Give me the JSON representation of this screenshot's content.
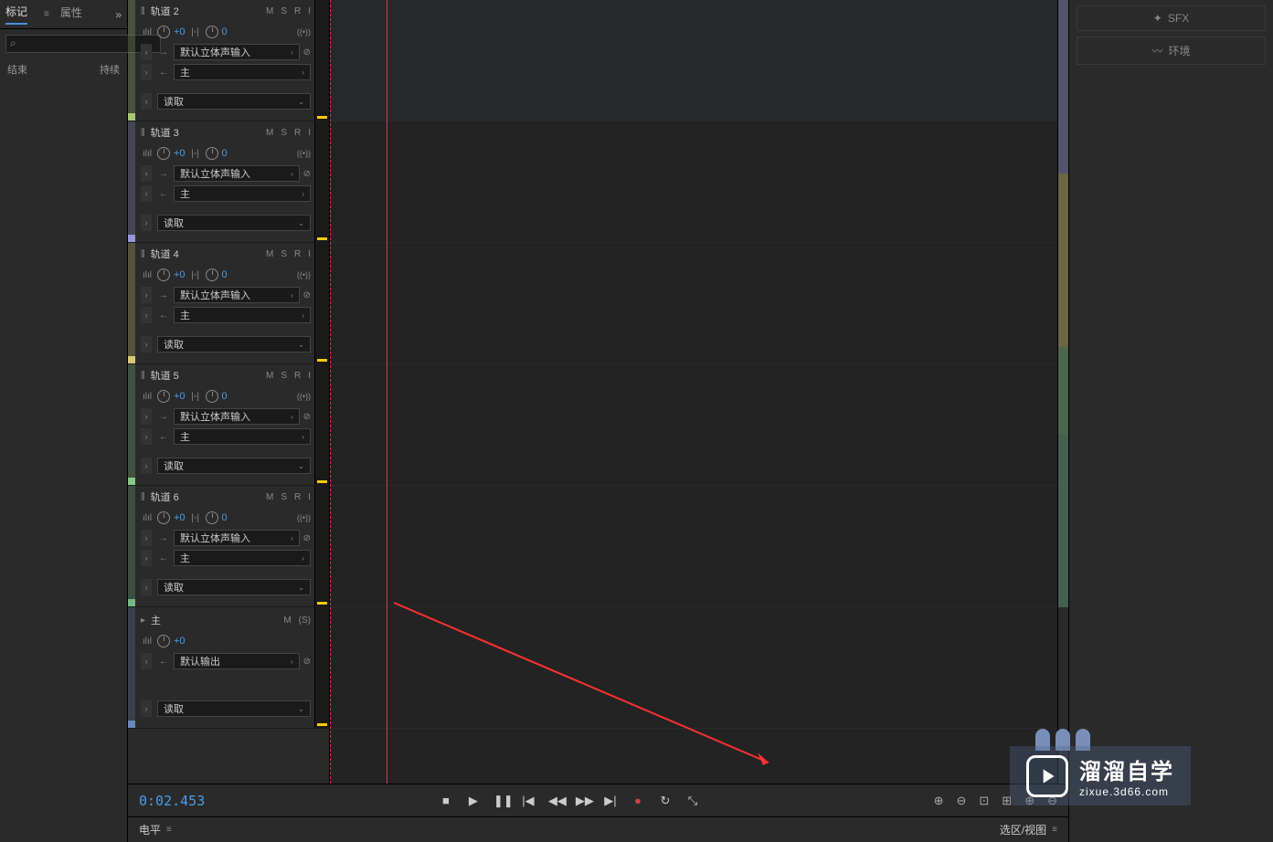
{
  "left": {
    "tab_markers": "标记",
    "tab_props": "属性",
    "search_placeholder": "",
    "col_end": "结束",
    "col_duration": "持续"
  },
  "tracks": [
    {
      "name": "轨道 2",
      "color": "#a8c878",
      "input": "默认立体声输入",
      "output": "主",
      "read": "读取",
      "vol": "+0",
      "pan": "0"
    },
    {
      "name": "轨道 3",
      "color": "#9898d8",
      "input": "默认立体声输入",
      "output": "主",
      "read": "读取",
      "vol": "+0",
      "pan": "0"
    },
    {
      "name": "轨道 4",
      "color": "#d8c878",
      "input": "默认立体声输入",
      "output": "主",
      "read": "读取",
      "vol": "+0",
      "pan": "0"
    },
    {
      "name": "轨道 5",
      "color": "#88c888",
      "input": "默认立体声输入",
      "output": "主",
      "read": "读取",
      "vol": "+0",
      "pan": "0"
    },
    {
      "name": "轨道 6",
      "color": "#78b888",
      "input": "默认立体声输入",
      "output": "主",
      "read": "读取",
      "vol": "+0",
      "pan": "0"
    }
  ],
  "master": {
    "name": "主",
    "output": "默认输出",
    "read": "读取",
    "vol": "+0",
    "color": "#6888b8"
  },
  "msr": {
    "m": "M",
    "s": "S",
    "r": "R",
    "i": "I",
    "s_paren": "(S)"
  },
  "transport": {
    "timecode": "0:02.453"
  },
  "bottom": {
    "level": "电平",
    "selection": "选区/视图"
  },
  "right": {
    "sfx": "SFX",
    "ambient": "环境"
  },
  "watermark": {
    "main": "溜溜自学",
    "sub": "zixue.3d66.com"
  },
  "scroll_colors": [
    "#9898d8",
    "#9898d8",
    "#d8c878",
    "#d8c878",
    "#88c888",
    "#78b888",
    "#78b888"
  ]
}
